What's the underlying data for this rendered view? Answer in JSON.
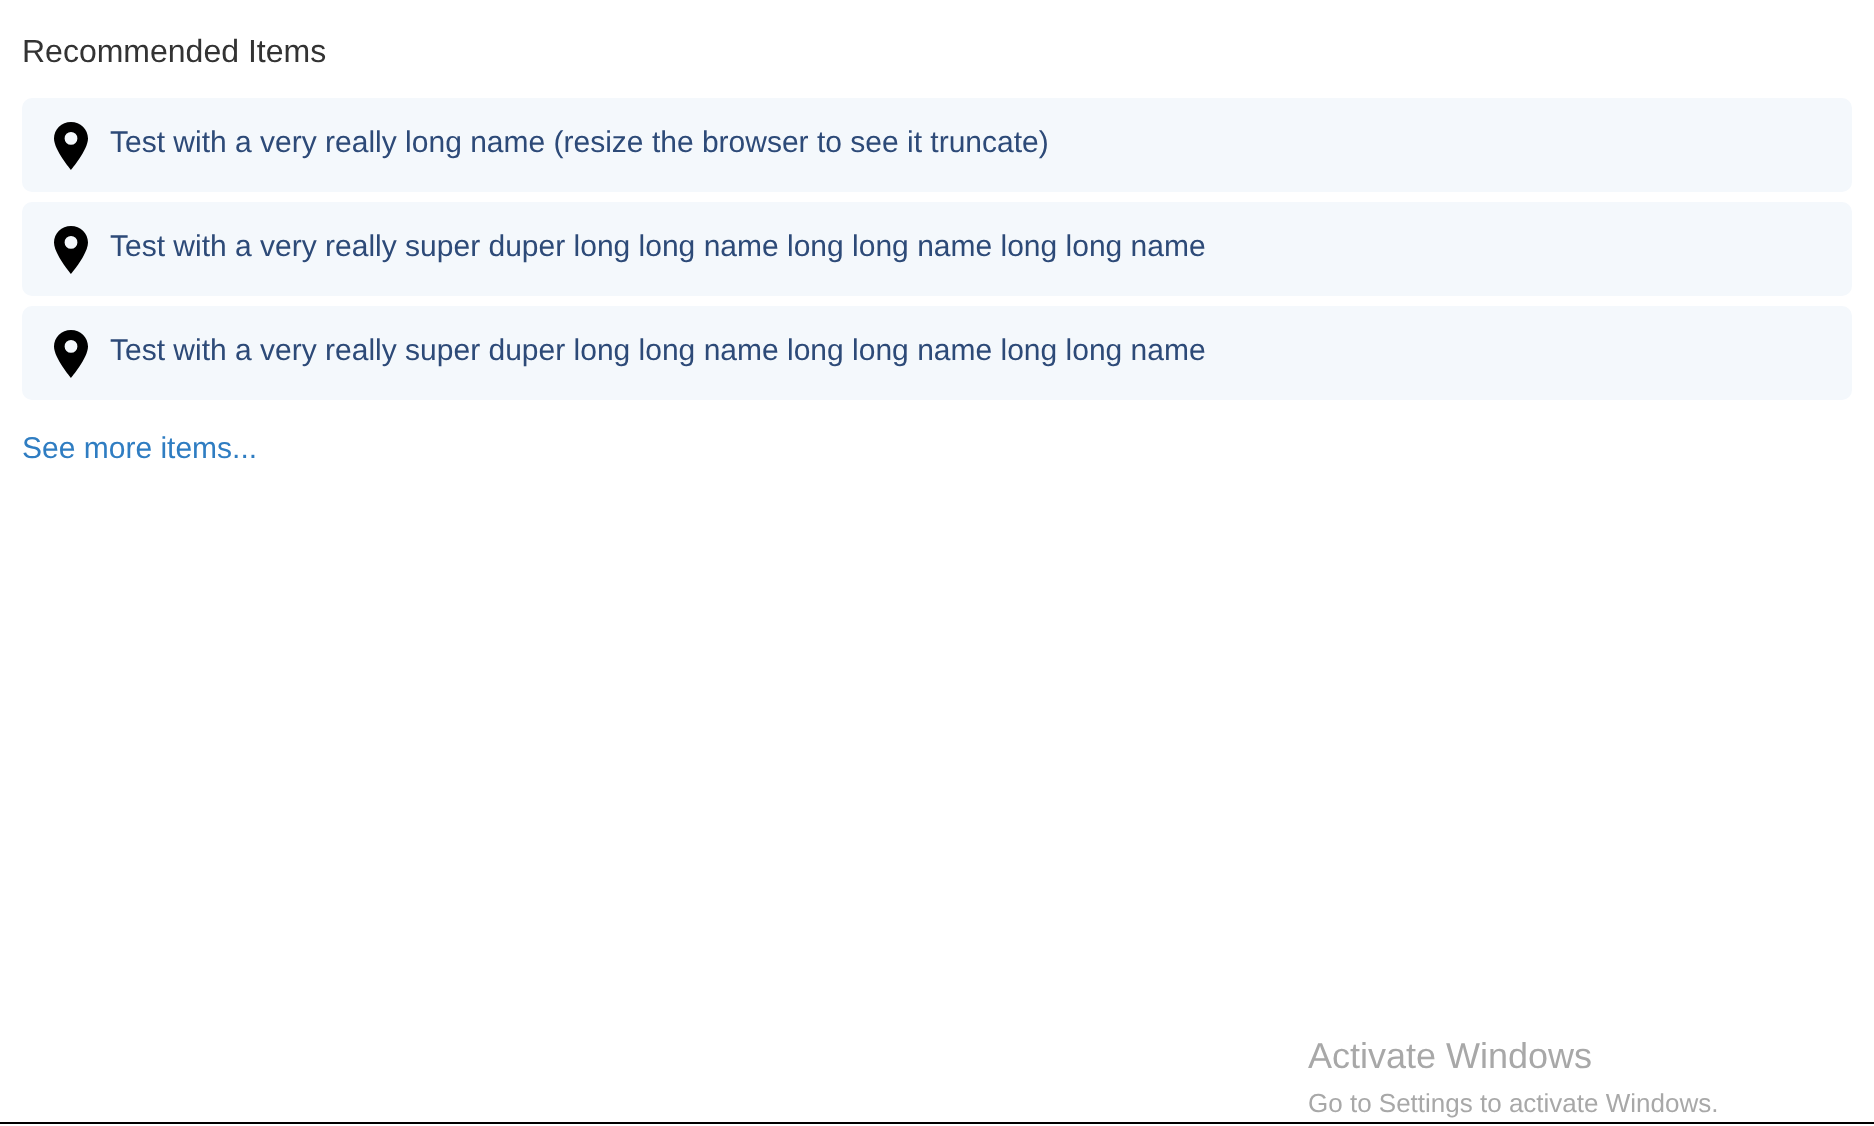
{
  "heading": "Recommended Items",
  "items": [
    {
      "label": "Test with a very really long name (resize the browser to see it truncate)"
    },
    {
      "label": "Test with a very really super duper long long name long long name long long name"
    },
    {
      "label": "Test with a very really super duper long long name long long name long long name"
    }
  ],
  "more_link": "See more items...",
  "os_notice": {
    "title": "Activate Windows",
    "subtitle": "Go to Settings to activate Windows."
  }
}
